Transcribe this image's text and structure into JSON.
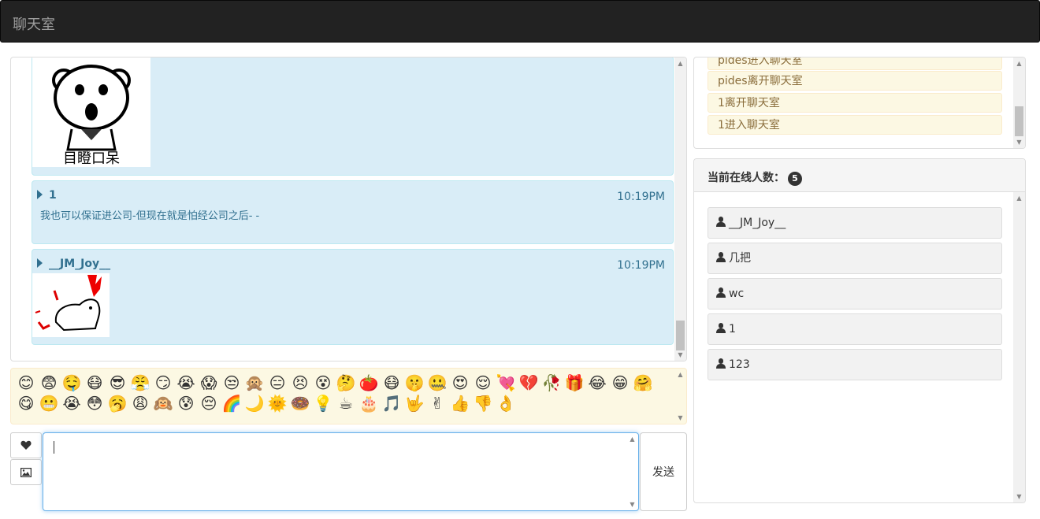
{
  "app": {
    "title": "聊天室"
  },
  "messages": [
    {
      "user": "",
      "time": "",
      "text": "",
      "sticker": "目瞪口呆"
    },
    {
      "user": "1",
      "time": "10:19PM",
      "text": "我也可以保证进公司-但现在就是怕经公司之后- -"
    },
    {
      "user": "__JM_Joy__",
      "time": "10:19PM",
      "text": "",
      "sticker": ""
    }
  ],
  "emoji_icons": [
    "😊",
    "😨",
    "🤤",
    "😷",
    "😎",
    "😤",
    "😏",
    "😭",
    "😱",
    "😒",
    "🙊",
    "😑",
    "😣",
    "😵",
    "🤔",
    "🍅",
    "😷",
    "🤫",
    "🤐",
    "😍",
    "😌",
    "💘",
    "💔",
    "🥀",
    "🎁",
    "😂",
    "😁",
    "🤗",
    "😋",
    "😬",
    "😭",
    "😳",
    "🥱",
    "😩",
    "🙉",
    "😰",
    "😔",
    "🌈",
    "🌙",
    "🌞",
    "🍩",
    "💡",
    "☕",
    "🎂",
    "🎵",
    "🤟",
    "✌",
    "👍",
    "👎",
    "👌"
  ],
  "input": {
    "value": "",
    "send_label": "发送"
  },
  "buttons": {
    "emoji_icon": "heart-icon",
    "image_icon": "picture-icon"
  },
  "log": [
    "pides进入聊天室",
    "pides离开聊天室",
    "1离开聊天室",
    "1进入聊天室"
  ],
  "online": {
    "title": "当前在线人数：",
    "count": "5",
    "users": [
      "__JM_Joy__",
      "几把",
      "wc",
      "1",
      "123"
    ]
  },
  "colors": {
    "navbar": "#222222",
    "message_bg": "#d9edf7",
    "message_text": "#31708f",
    "warning_bg": "#fcf8e3",
    "warning_text": "#8a6d3b"
  }
}
